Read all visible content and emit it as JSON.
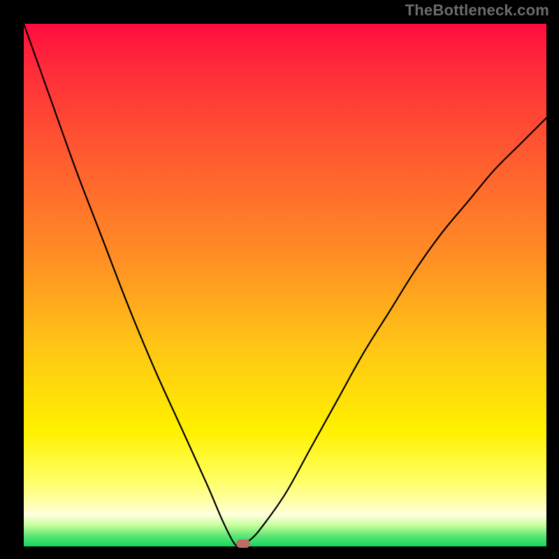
{
  "watermark": "TheBottleneck.com",
  "chart_data": {
    "type": "line",
    "title": "",
    "xlabel": "",
    "ylabel": "",
    "xlim": [
      0,
      100
    ],
    "ylim": [
      0,
      100
    ],
    "grid": false,
    "background_gradient": {
      "top": "#ff0d3f",
      "midtop": "#ff8f24",
      "mid": "#fff100",
      "midbottom": "#ffffa0",
      "bottom": "#13d65e"
    },
    "series": [
      {
        "name": "bottleneck-curve",
        "x": [
          0,
          5,
          10,
          15,
          20,
          25,
          30,
          35,
          38,
          40,
          41,
          42,
          43,
          45,
          50,
          55,
          60,
          65,
          70,
          75,
          80,
          85,
          90,
          95,
          100
        ],
        "y": [
          100,
          86,
          72,
          59,
          46,
          34,
          23,
          12,
          5,
          1,
          0,
          0,
          1,
          3,
          10,
          19,
          28,
          37,
          45,
          53,
          60,
          66,
          72,
          77,
          82
        ]
      }
    ],
    "marker": {
      "name": "optimal-point",
      "x": 42,
      "y": 0,
      "color": "#C26A69"
    }
  }
}
